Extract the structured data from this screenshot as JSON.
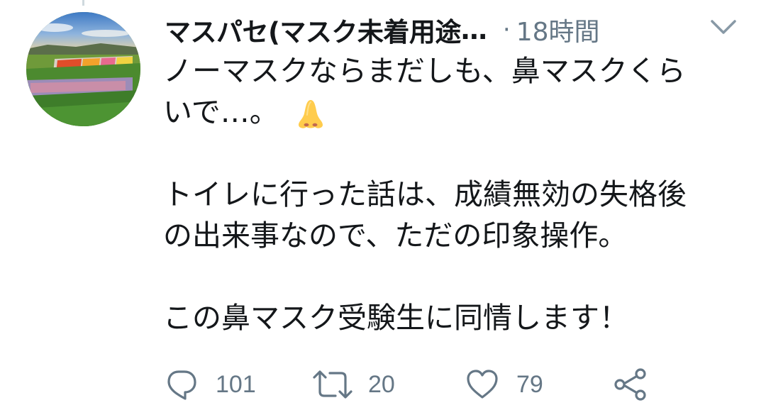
{
  "tweet": {
    "display_name": "マスパセ(マスク未着用途",
    "name_ellipsis": "…",
    "separator": "·",
    "time": "18時間",
    "caret_icon": "chevron-down-icon",
    "avatar_icon": "flower-field-avatar",
    "paragraphs": [
      {
        "lines": [
          "ノーマスクならまだしも、鼻マスクくら",
          "いで…。"
        ],
        "trailing_emoji": "nose-emoji"
      },
      {
        "lines": [
          "トイレに行った話は、成績無効の失格後",
          "の出来事なので、ただの印象操作。"
        ]
      },
      {
        "lines": [
          "この鼻マスク受験生に同情します！"
        ]
      }
    ]
  },
  "actions": {
    "reply": {
      "icon": "reply-icon",
      "count": "101"
    },
    "retweet": {
      "icon": "retweet-icon",
      "count": "20"
    },
    "like": {
      "icon": "heart-icon",
      "count": "79"
    },
    "share": {
      "icon": "share-icon"
    }
  },
  "colors": {
    "text": "#14171a",
    "muted": "#657786",
    "nose_yellow": "#ffcc4d"
  }
}
